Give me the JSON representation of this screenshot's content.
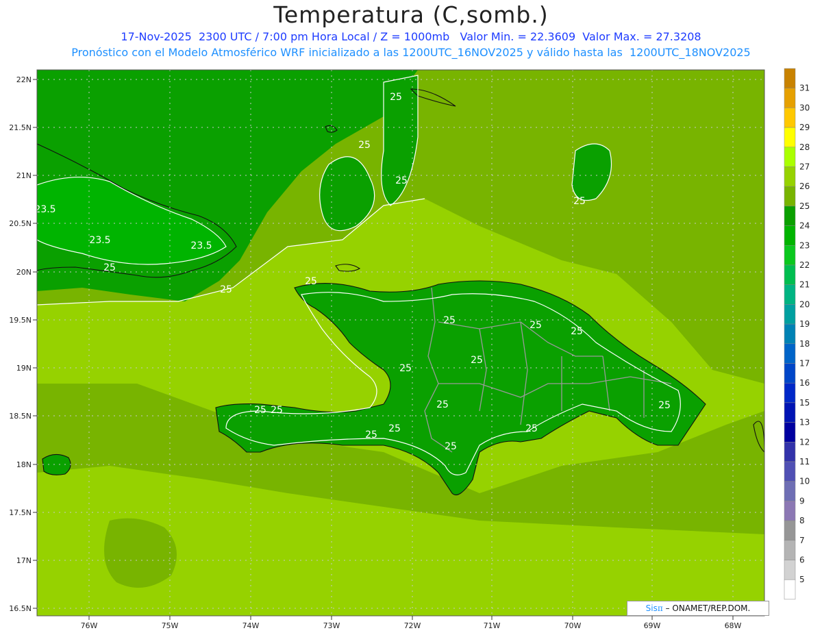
{
  "header": {
    "title": "Temperatura (C,somb.)",
    "line1": "17-Nov-2025  2300 UTC / 7:00 pm Hora Local / Z = 1000mb   Valor Min. = 22.3609  Valor Max. = 27.3208",
    "line2": "Pronóstico con el Modelo Atmosférico WRF inicializado a las 1200UTC_16NOV2025 y válido hasta las  1200UTC_18NOV2025"
  },
  "axes": {
    "lat_labels": [
      "22N",
      "21.5N",
      "21N",
      "20.5N",
      "20N",
      "19.5N",
      "19N",
      "18.5N",
      "18N",
      "17.5N",
      "17N",
      "16.5N"
    ],
    "lon_labels": [
      "76W",
      "75W",
      "74W",
      "73W",
      "72W",
      "71W",
      "70W",
      "69W",
      "68W"
    ]
  },
  "colorbar": {
    "labels": [
      "31",
      "30",
      "29",
      "28",
      "27",
      "26",
      "25",
      "24",
      "23",
      "22",
      "21",
      "20",
      "19",
      "18",
      "17",
      "16",
      "15",
      "13",
      "12",
      "11",
      "10",
      "9",
      "8",
      "7",
      "6",
      "5"
    ],
    "colors": [
      "#c88200",
      "#e6a000",
      "#ffc800",
      "#ffff00",
      "#aaff00",
      "#96d200",
      "#78b400",
      "#0aa000",
      "#00b400",
      "#0ac81e",
      "#00be50",
      "#00b482",
      "#00a0a0",
      "#0082b4",
      "#0064c8",
      "#0046c8",
      "#0028c8",
      "#0014b4",
      "#0000a0",
      "#3232aa",
      "#5050b4",
      "#6e6eb4",
      "#8c78b4",
      "#969696",
      "#b4b4b4",
      "#d2d2d2",
      "#ffffff"
    ]
  },
  "contours": {
    "labels": [
      "25",
      "25",
      "25",
      "23.5",
      "23.5",
      "23.5",
      "25",
      "25",
      "25",
      "25",
      "25",
      "25",
      "25",
      "25",
      "25",
      "25",
      "25",
      "25",
      "25",
      "25",
      "25",
      "25",
      "25"
    ]
  },
  "colors": {
    "land_dark": "#0aa000",
    "sea_mid": "#78b400",
    "sea_light": "#96d200"
  },
  "credit": {
    "sis": "Sis",
    "pi": "π",
    "text": "– ONAMET/REP.DOM."
  }
}
